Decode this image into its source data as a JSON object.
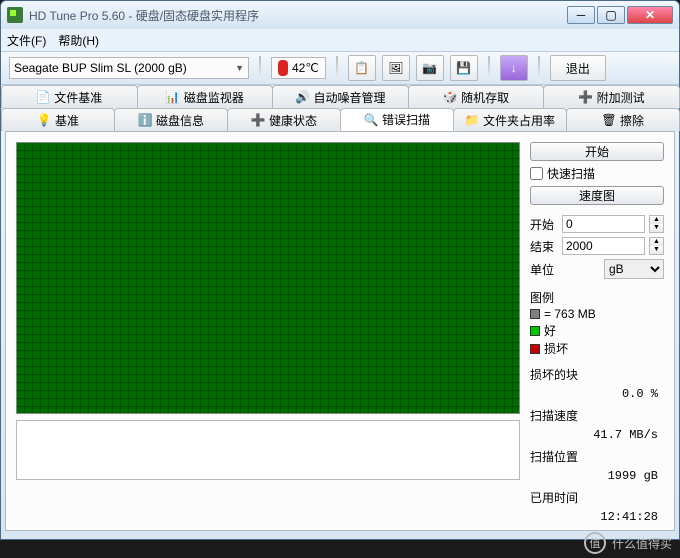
{
  "window": {
    "title": "HD Tune Pro 5.60 - 硬盘/固态硬盘实用程序"
  },
  "menu": {
    "file": "文件(F)",
    "help": "帮助(H)"
  },
  "toolbar": {
    "drive": "Seagate BUP Slim SL (2000 gB)",
    "temperature": "42℃",
    "exit": "退出"
  },
  "tabs_top": [
    {
      "icon": "file-base-icon",
      "label": "文件基准"
    },
    {
      "icon": "disk-monitor-icon",
      "label": "磁盘监视器"
    },
    {
      "icon": "aam-icon",
      "label": "自动噪音管理"
    },
    {
      "icon": "random-access-icon",
      "label": "随机存取"
    },
    {
      "icon": "extra-test-icon",
      "label": "附加测试"
    }
  ],
  "tabs_bottom": [
    {
      "icon": "benchmark-icon",
      "label": "基准"
    },
    {
      "icon": "disk-info-icon",
      "label": "磁盘信息"
    },
    {
      "icon": "health-icon",
      "label": "健康状态"
    },
    {
      "icon": "error-scan-icon",
      "label": "错误扫描",
      "active": true
    },
    {
      "icon": "folder-usage-icon",
      "label": "文件夹占用率"
    },
    {
      "icon": "erase-icon",
      "label": "擦除"
    }
  ],
  "side": {
    "start": "开始",
    "quick_scan": "快速扫描",
    "speed_map": "速度图",
    "start_label": "开始",
    "start_val": "0",
    "end_label": "结束",
    "end_val": "2000",
    "unit_label": "单位",
    "unit_val": "gB",
    "legend_title": "图例",
    "legend_block": "= 763 MB",
    "legend_ok": "好",
    "legend_bad": "损坏",
    "damaged_label": "损坏的块",
    "damaged_val": "0.0 %",
    "speed_label": "扫描速度",
    "speed_val": "41.7 MB/s",
    "pos_label": "扫描位置",
    "pos_val": "1999 gB",
    "elapsed_label": "已用时间",
    "elapsed_val": "12:41:28"
  },
  "colors": {
    "ok": "#00c800",
    "bad": "#c80000",
    "block": "#808080"
  },
  "watermark": "什么值得买"
}
